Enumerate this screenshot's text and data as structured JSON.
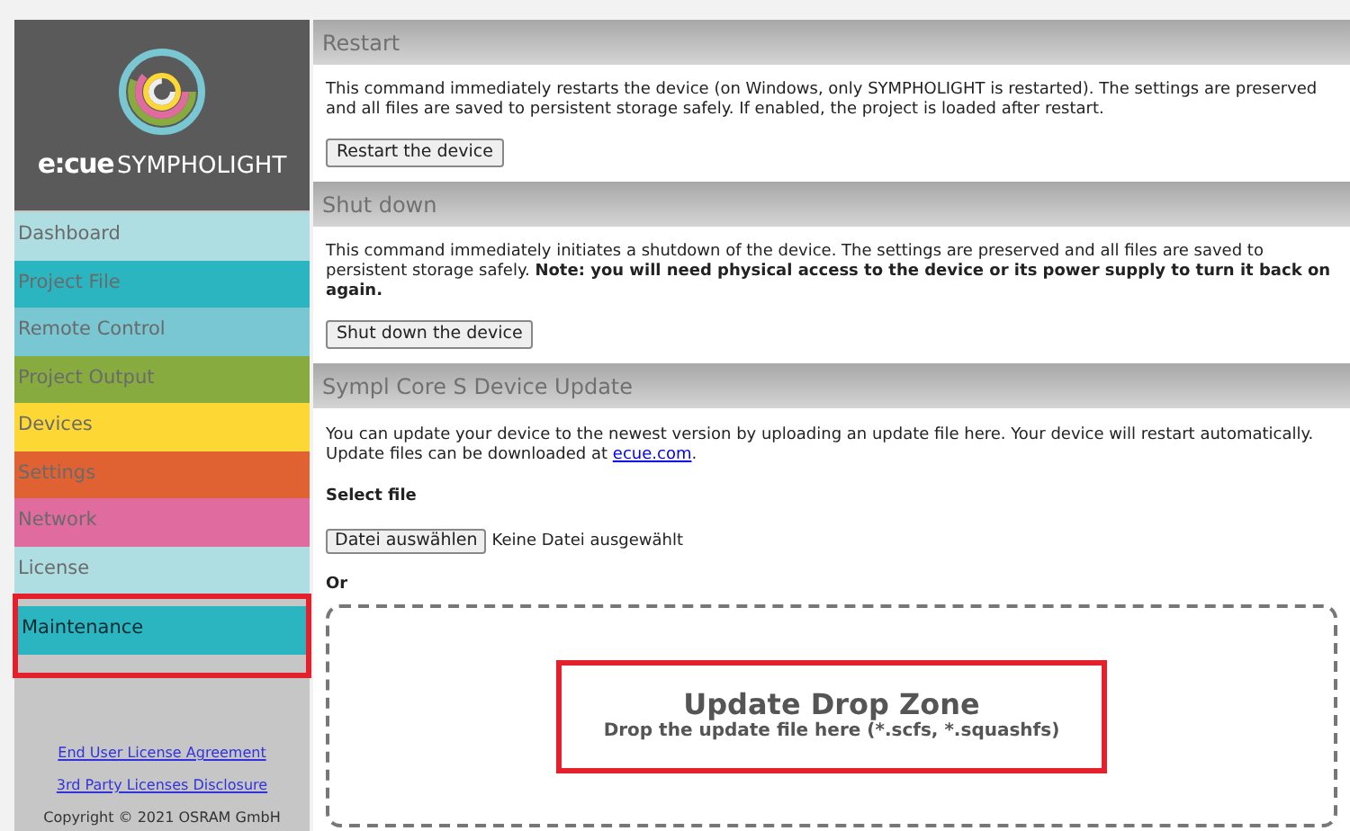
{
  "logo": {
    "brand": "e:cue",
    "product": "SYMPHOLIGHT"
  },
  "nav": [
    {
      "label": "Dashboard",
      "color": "#aedde2",
      "selected": false
    },
    {
      "label": "Project File",
      "color": "#2ab5c0",
      "selected": false
    },
    {
      "label": "Remote Control",
      "color": "#79c7d2",
      "selected": false
    },
    {
      "label": "Project Output",
      "color": "#88ab3f",
      "selected": false
    },
    {
      "label": "Devices",
      "color": "#fdd835",
      "selected": false
    },
    {
      "label": "Settings",
      "color": "#e06233",
      "selected": false
    },
    {
      "label": "Network",
      "color": "#e06b9f",
      "selected": false
    },
    {
      "label": "License",
      "color": "#aedde2",
      "selected": false
    },
    {
      "label": "Maintenance",
      "color": "#2ab5c0",
      "selected": true
    }
  ],
  "footer": {
    "links": [
      "End User License Agreement",
      "3rd Party Licenses Disclosure"
    ],
    "copyright": "Copyright © 2021 OSRAM GmbH"
  },
  "sections": [
    {
      "kind": "command",
      "title": "Restart",
      "text": "This command immediately restarts the device (on Windows, only SYMPHOLIGHT is restarted). The settings are preserved and all files are saved to persistent storage safely. If enabled, the project is loaded after restart.",
      "button": "Restart the device"
    },
    {
      "kind": "command",
      "title": "Shut down",
      "text": "This command immediately initiates a shutdown of the device. The settings are preserved and all files are saved to persistent storage safely. **Note: you will need physical access to the device or its power supply to turn it back on again.**",
      "button": "Shut down the device"
    },
    {
      "kind": "update",
      "title": "Sympl Core S Device Update",
      "text": "You can update your device to the newest version by uploading an update file here. Your device will restart automatically. Update files can be downloaded at",
      "link": "ecue.com",
      "after_link": ".",
      "select_label": "Select file",
      "file_button": "Datei auswählen",
      "file_status": "Keine Datei ausgewählt",
      "or": "Or",
      "drop_title": "Update Drop Zone",
      "drop_hint": "Drop the update file here (*.scfs, *.squashfs)"
    }
  ]
}
